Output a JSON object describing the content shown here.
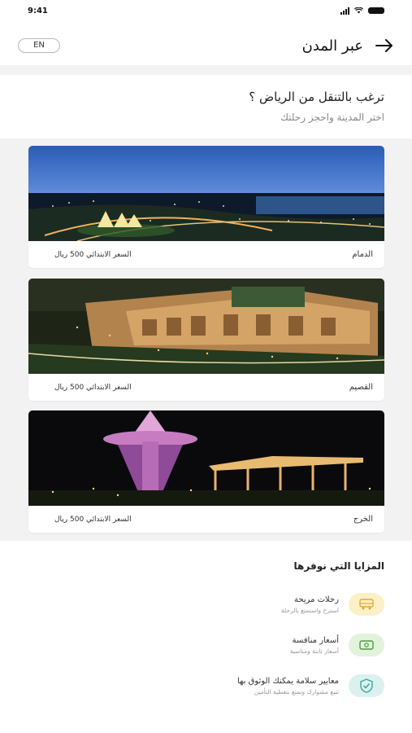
{
  "status": {
    "time": "9:41"
  },
  "header": {
    "title": "عبر المدن",
    "lang_button": "EN"
  },
  "intro": {
    "question": "ترغب بالتنقل من الرياض ؟",
    "subtitle": "اختر المدينة واحجز رحلتك"
  },
  "cities": [
    {
      "name": "الدمام",
      "price": "السعر الابتدائي 500 ريال"
    },
    {
      "name": "القصيم",
      "price": "السعر الابتدائي 500 ريال"
    },
    {
      "name": "الخرج",
      "price": "السعر الابتدائي 500 ريال"
    }
  ],
  "features": {
    "title": "المزايا التي نوفرها",
    "items": [
      {
        "title": "رحلات مريحة",
        "desc": "استرخ واستمتع بالرحلة",
        "icon": "bus-icon",
        "color": "#fdf0c7"
      },
      {
        "title": "أسعار منافسة",
        "desc": "أسعار ثابتة ومناسبة",
        "icon": "money-icon",
        "color": "#e2f3dc"
      },
      {
        "title": "معايير سلامة يمكنك الوثوق بها",
        "desc": "تتبع مشوارك وتمتع بتغطية التأمين",
        "icon": "shield-check-icon",
        "color": "#dcf1ef"
      }
    ]
  }
}
